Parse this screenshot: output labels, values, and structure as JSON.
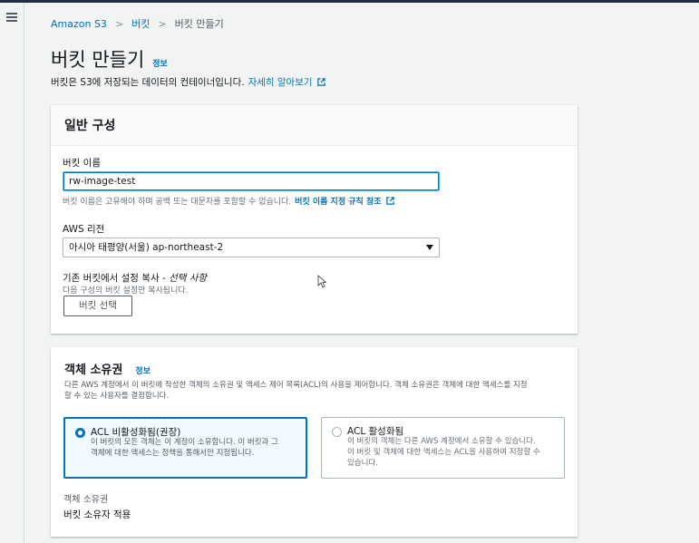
{
  "nav": {
    "menu_icon": "hamburger-icon"
  },
  "breadcrumb": {
    "items": [
      "Amazon S3",
      "버킷",
      "버킷 만들기"
    ]
  },
  "page": {
    "title": "버킷 만들기",
    "info_label": "정보",
    "description": "버킷은 S3에 저장되는 데이터의 컨테이너입니다.",
    "learn_more": "자세히 알아보기"
  },
  "general": {
    "header": "일반 구성",
    "bucket_name_label": "버킷 이름",
    "bucket_name_value": "rw-image-test",
    "bucket_name_hint": "버킷 이름은 고유해야 하며 공백 또는 대문자를 포함할 수 없습니다.",
    "bucket_name_rules_link": "버킷 이름 지정 규칙 참조",
    "region_label": "AWS 리전",
    "region_value": "아시아 태평양(서울) ap-northeast-2",
    "copy_label": "기존 버킷에서 설정 복사 -",
    "copy_optional": "선택 사항",
    "copy_hint": "다음 구성의 버킷 설정만 복사됩니다.",
    "choose_bucket_button": "버킷 선택"
  },
  "ownership": {
    "header": "객체 소유권",
    "info_label": "정보",
    "description_line1": "다른 AWS 계정에서 이 버킷에 작성한 객체의 소유권 및 액세스 제어 목록(ACL)의 사용을 제어합니다. 객체 소유권은 객체에 대한 액세스를 지정",
    "description_line2": "할 수 있는 사용자를 결정합니다.",
    "option1_title": "ACL 비활성화됨(권장)",
    "option1_desc_line1": "이 버킷의 모든 객체는 이 계정이 소유합니다. 이 버킷과 그",
    "option1_desc_line2": "객체에 대한 액세스는 정책을 통해서만 지정됩니다.",
    "option2_title": "ACL 활성화됨",
    "option2_desc_line1": "이 버킷의 객체는 다른 AWS 계정에서 소유할 수 있습니다.",
    "option2_desc_line2": "이 버킷 및 객체에 대한 액세스는 ACL을 사용하여 지정할 수",
    "option2_desc_line3": "있습니다.",
    "result_label": "객체 소유권",
    "result_value": "버킷 소유자 적용"
  },
  "colors": {
    "link": "#0073bb",
    "selected_border": "#0073bb",
    "page_bg": "#f2f3f3"
  }
}
